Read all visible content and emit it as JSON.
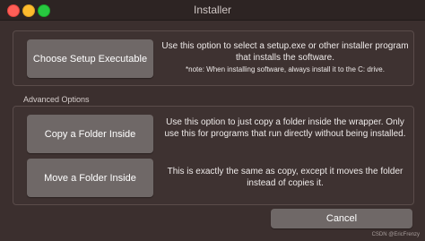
{
  "window": {
    "title": "Installer"
  },
  "main": {
    "setup_button_label": "Choose Setup Executable",
    "setup_description": "Use this option to select a setup.exe or other installer program that installs the software.",
    "setup_note": "*note: When installing software, always install it to the C: drive."
  },
  "advanced": {
    "label": "Advanced Options",
    "copy_button_label": "Copy a Folder Inside",
    "copy_description": "Use this option to just copy a folder inside the wrapper. Only use this for programs that run directly without being installed.",
    "move_button_label": "Move a Folder Inside",
    "move_description": "This is exactly the same as copy, except it moves the folder instead of copies it."
  },
  "footer": {
    "cancel_label": "Cancel",
    "watermark": "CSDN @EricFrenzy"
  },
  "colors": {
    "background": "#3b2f2e",
    "button": "#6f6867",
    "close": "#fe5f57",
    "minimize": "#febc2e",
    "maximize": "#28c840"
  }
}
